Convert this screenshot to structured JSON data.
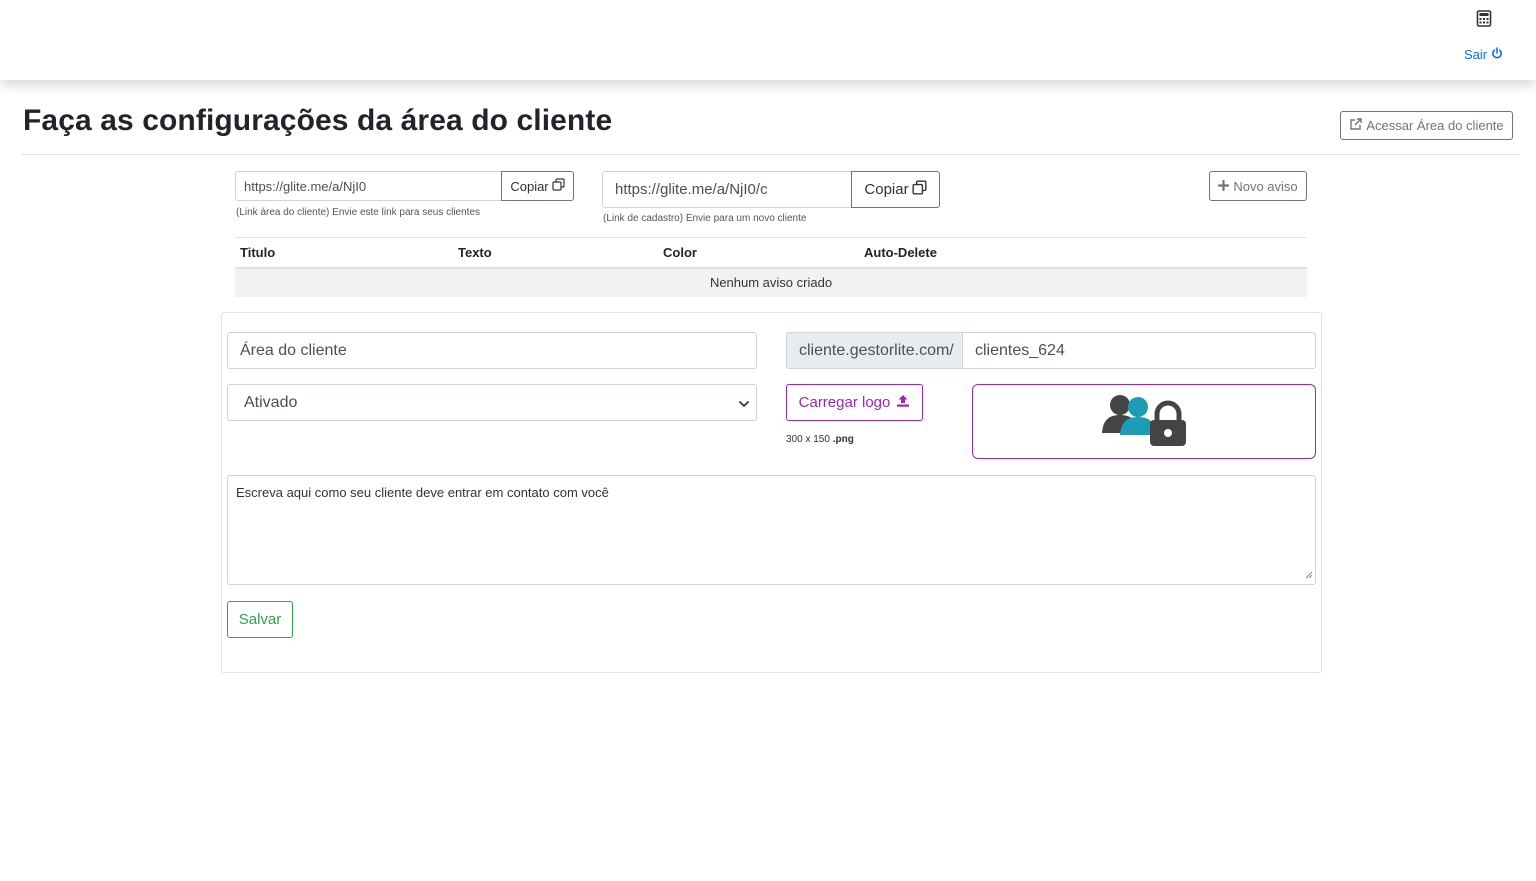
{
  "topbar": {
    "calculator_icon": "calculator-icon",
    "logout_label": "Sair",
    "logout_icon": "power-icon",
    "link_color": "#0d6efd"
  },
  "header": {
    "title": "Faça as configurações da área do cliente",
    "access_button_label": "Acessar Área do cliente",
    "access_button_icon": "external-link-icon"
  },
  "links": {
    "client_area": {
      "value": "https://glite.me/a/NjI0",
      "copy_label": "Copiar",
      "help": "(Link área do cliente) Envie este link para seus clientes"
    },
    "signup": {
      "value": "https://glite.me/a/NjI0/c",
      "copy_label": "Copiar",
      "help": "(Link de cadastro) Envie para um novo cliente"
    },
    "copy_icon": "copy-icon"
  },
  "notices": {
    "new_button_label": "Novo aviso",
    "new_button_icon": "plus-icon",
    "columns": [
      "Titulo",
      "Texto",
      "Color",
      "Auto-Delete"
    ],
    "empty_message": "Nenhum aviso criado"
  },
  "form": {
    "area_name_value": "Área do cliente",
    "domain_prefix": "cliente.gestorlite.com/",
    "subdomain_value": "clientes_624",
    "status_selected": "Ativado",
    "upload_label": "Carregar logo",
    "upload_icon": "upload-icon",
    "logo_size": "300 x 150",
    "logo_format": ".png",
    "logo_icon": "users-lock-icon",
    "contact_text": "Escreva aqui como seu cliente deve entrar em contato com você",
    "save_label": "Salvar",
    "accent_color": "#9c27b0",
    "save_color": "#28a745"
  }
}
